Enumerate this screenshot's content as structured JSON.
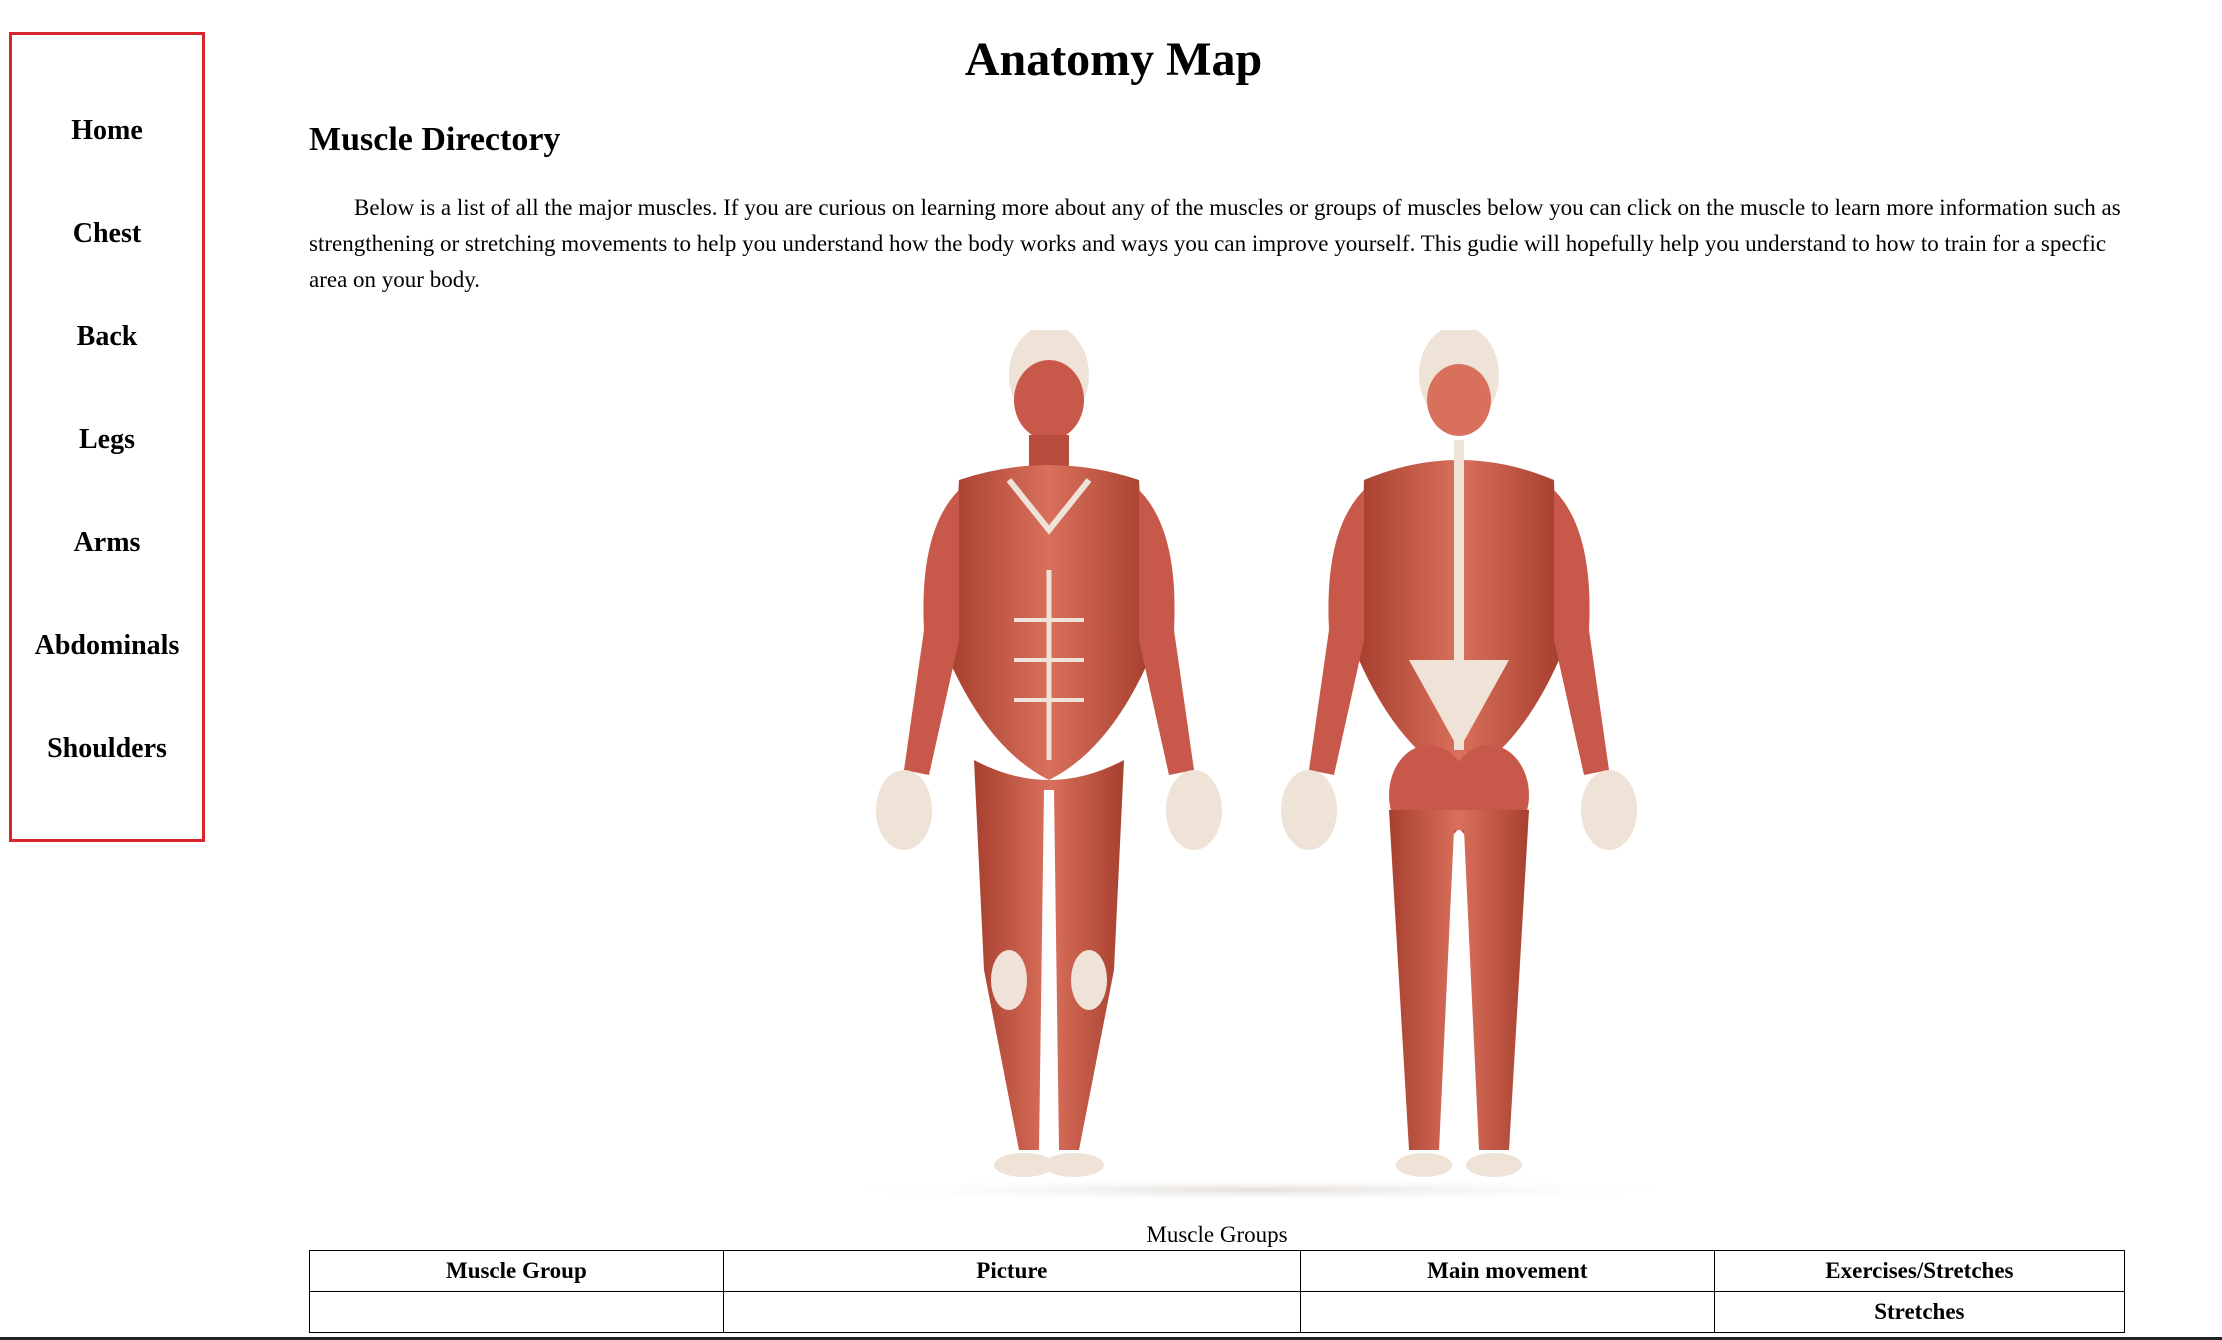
{
  "sidebar": {
    "items": [
      {
        "label": "Home"
      },
      {
        "label": "Chest"
      },
      {
        "label": "Back"
      },
      {
        "label": "Legs"
      },
      {
        "label": "Arms"
      },
      {
        "label": "Abdominals"
      },
      {
        "label": "Shoulders"
      }
    ],
    "border_color": "#d9262c"
  },
  "header": {
    "title": "Anatomy Map"
  },
  "main": {
    "section_title": "Muscle Directory",
    "intro": "Below is a list of all the major muscles. If you are curious on learning more about any of the muscles or groups of muscles below you can click on the muscle to learn more information such as strengthening or stretching movements to help you understand how the body works and ways you can improve yourself. This gudie will hopefully help you understand to how to train for a specfic area on your body.",
    "figure": {
      "colors": {
        "muscle": "#c8584a",
        "tendon": "#efe2d6",
        "skin_shadow": "#9c3a2e"
      }
    },
    "table": {
      "caption": "Muscle Groups",
      "headers": [
        "Muscle Group",
        "Picture",
        "Main movement",
        "Exercises/Stretches"
      ],
      "row1": [
        "",
        "",
        "",
        "Stretches"
      ]
    }
  }
}
